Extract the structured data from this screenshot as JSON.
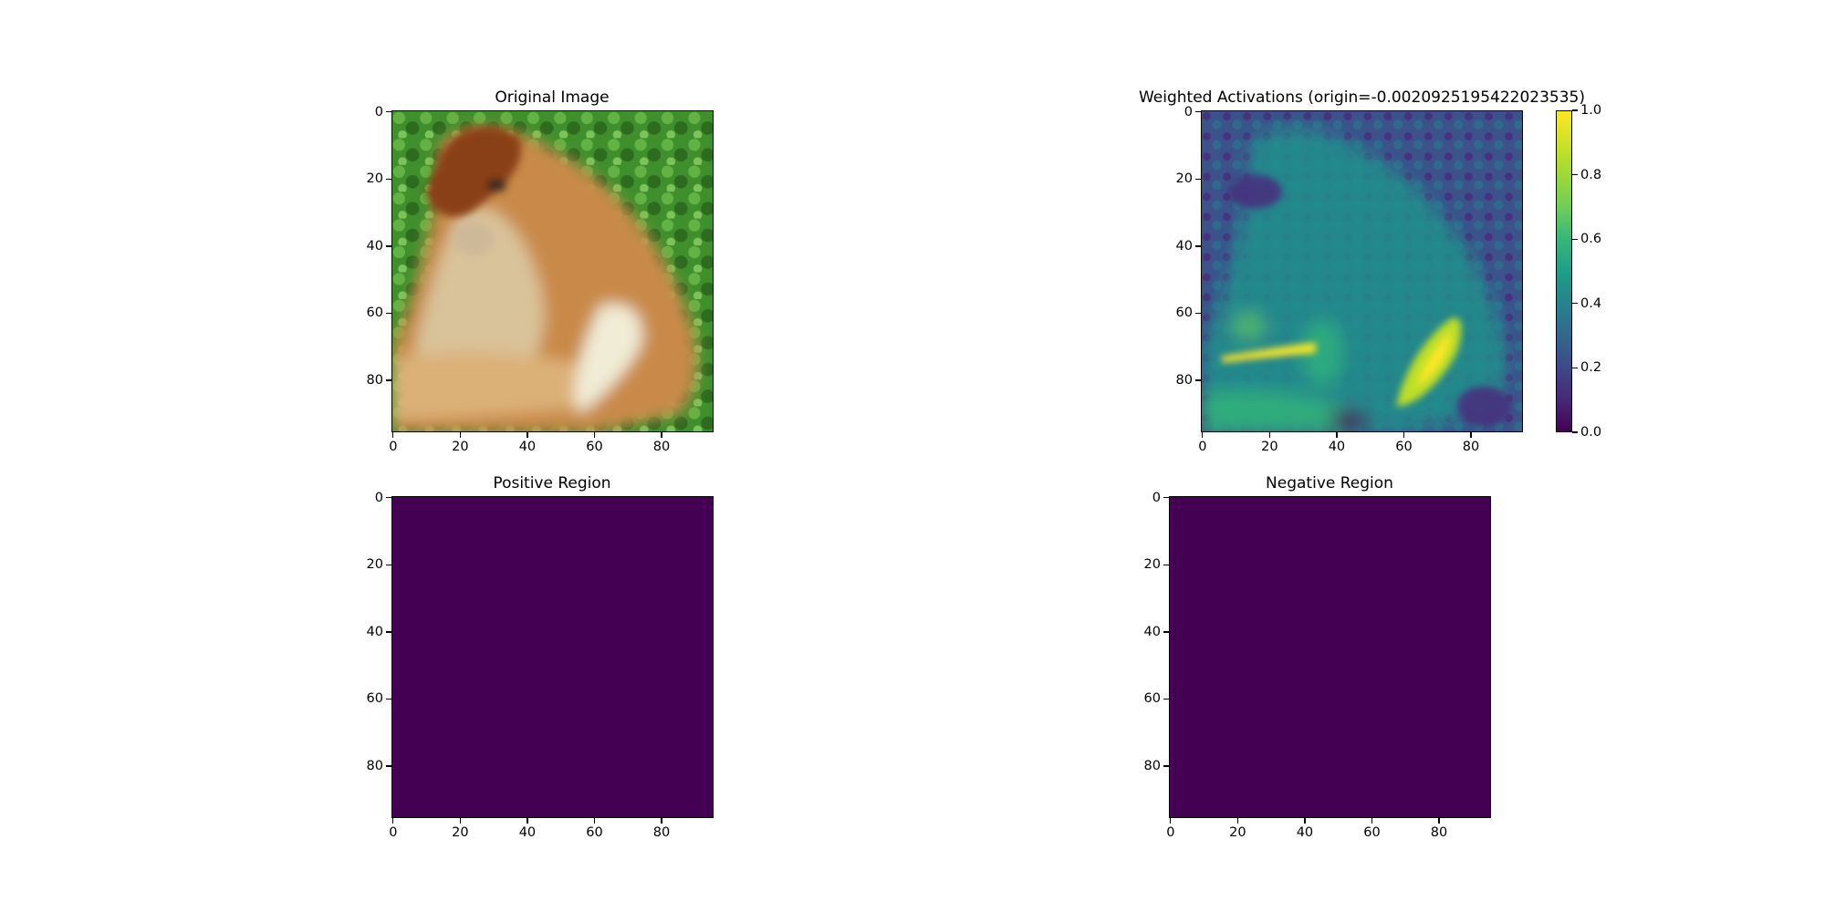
{
  "figure": {
    "background": "#ffffff"
  },
  "chart_data": [
    {
      "id": "original",
      "type": "heatmap",
      "title": "Original Image",
      "image_content": "rgb photograph of a monkey",
      "xlim": [
        -0.5,
        95.5
      ],
      "ylim": [
        95.5,
        -0.5
      ],
      "x_ticks": [
        0,
        20,
        40,
        60,
        80
      ],
      "y_ticks": [
        0,
        20,
        40,
        60,
        80
      ],
      "colors": {
        "foliage": "#3f8f2c",
        "fur_orange": "#c98a4a",
        "fur_dark": "#8a3f17",
        "fur_pale": "#e6dcb8"
      }
    },
    {
      "id": "weighted",
      "type": "heatmap",
      "title": "Weighted Activations (origin=-0.0020925195422023535)",
      "colormap": "viridis",
      "xlim": [
        -0.5,
        95.5
      ],
      "ylim": [
        95.5,
        -0.5
      ],
      "x_ticks": [
        0,
        20,
        40,
        60,
        80
      ],
      "y_ticks": [
        0,
        20,
        40,
        60,
        80
      ],
      "colorbar": {
        "range": [
          0.0,
          1.0
        ],
        "ticks": [
          "0.0",
          "0.2",
          "0.4",
          "0.6",
          "0.8",
          "1.0"
        ]
      }
    },
    {
      "id": "positive",
      "type": "heatmap",
      "title": "Positive Region",
      "colormap": "viridis",
      "uniform_value": 0,
      "fill_color": "#440154",
      "xlim": [
        -0.5,
        95.5
      ],
      "ylim": [
        95.5,
        -0.5
      ],
      "x_ticks": [
        0,
        20,
        40,
        60,
        80
      ],
      "y_ticks": [
        0,
        20,
        40,
        60,
        80
      ]
    },
    {
      "id": "negative",
      "type": "heatmap",
      "title": "Negative Region",
      "colormap": "viridis",
      "uniform_value": 0,
      "fill_color": "#440154",
      "xlim": [
        -0.5,
        95.5
      ],
      "ylim": [
        95.5,
        -0.5
      ],
      "x_ticks": [
        0,
        20,
        40,
        60,
        80
      ],
      "y_ticks": [
        0,
        20,
        40,
        60,
        80
      ]
    }
  ]
}
